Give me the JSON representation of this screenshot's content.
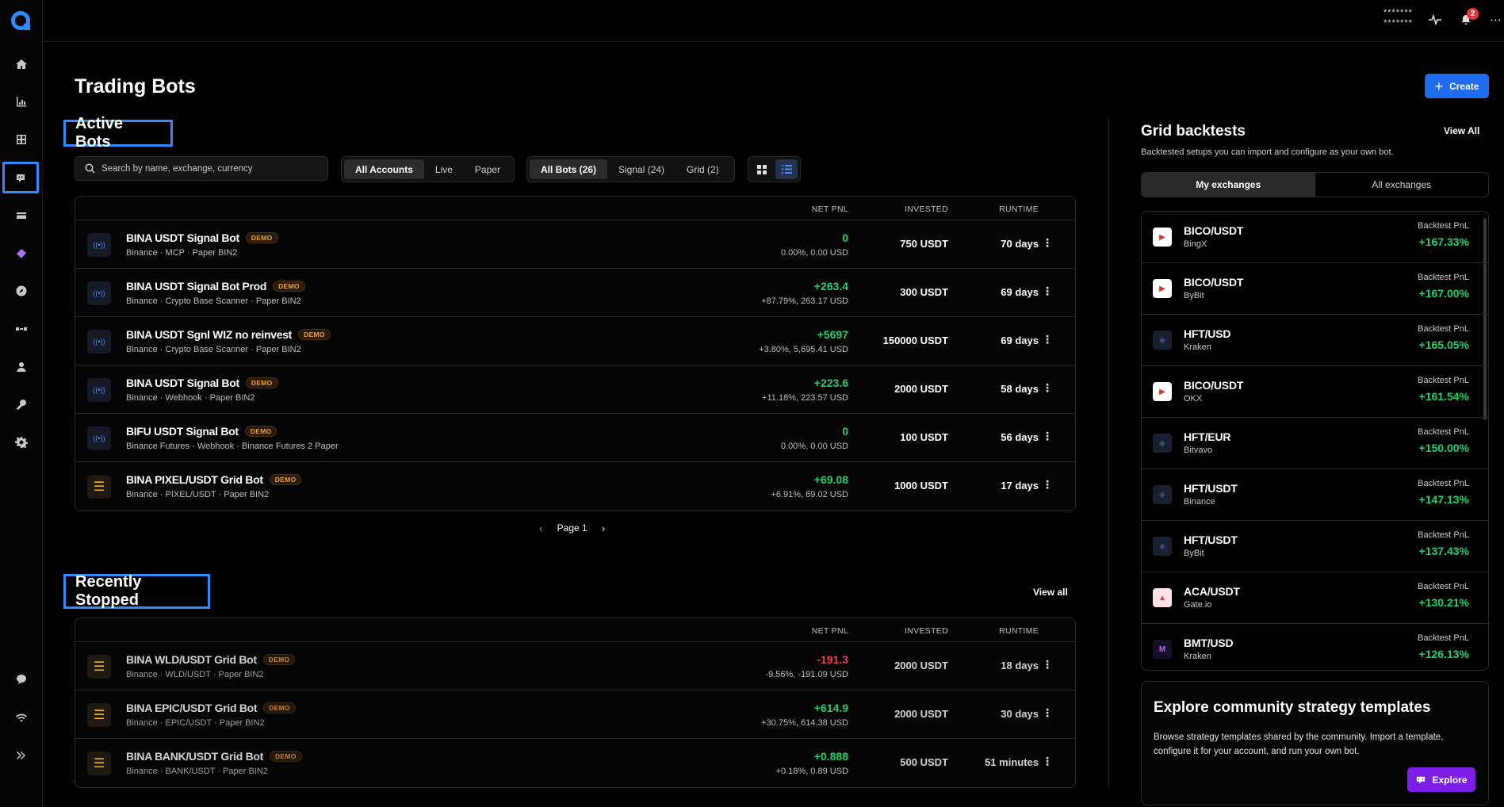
{
  "topbar": {
    "masked_line1": "*******",
    "masked_line2": "*******",
    "notification_count": "2"
  },
  "sidebar": {
    "items": [
      "home-icon",
      "chart-icon",
      "grid-icon",
      "bot-icon",
      "card-icon",
      "layers-icon",
      "compass-icon",
      "connection-icon",
      "user-icon",
      "key-icon",
      "settings-icon"
    ],
    "bottom": [
      "chat-icon",
      "wifi-icon",
      "expand-icon"
    ]
  },
  "page": {
    "title": "Trading Bots",
    "create_label": "Create"
  },
  "active": {
    "section_title": "Active Bots",
    "search_placeholder": "Search by name, exchange, currency",
    "accounts": [
      "All Accounts",
      "Live",
      "Paper"
    ],
    "bot_filters": [
      "All Bots (26)",
      "Signal (24)",
      "Grid (2)"
    ],
    "columns": {
      "pnl": "NET PNL",
      "invested": "INVESTED",
      "runtime": "RUNTIME"
    },
    "rows": [
      {
        "type": "signal",
        "name": "BINA USDT Signal Bot",
        "badge": "DEMO",
        "sub": "Binance · MCP · Paper BIN2",
        "pnl": "0",
        "pnl_sub": "0.00%, 0.00 USD",
        "invested": "750 USDT",
        "runtime": "70 days"
      },
      {
        "type": "signal",
        "name": "BINA USDT Signal Bot Prod",
        "badge": "DEMO",
        "sub": "Binance · Crypto Base Scanner · Paper BIN2",
        "pnl": "+263.4",
        "pnl_sub": "+87.79%, 263.17 USD",
        "invested": "300 USDT",
        "runtime": "69 days"
      },
      {
        "type": "signal",
        "name": "BINA USDT Sgnl WIZ no reinvest",
        "badge": "DEMO",
        "sub": "Binance · Crypto Base Scanner · Paper BIN2",
        "pnl": "+5697",
        "pnl_sub": "+3.80%, 5,695.41 USD",
        "invested": "150000 USDT",
        "runtime": "69 days"
      },
      {
        "type": "signal",
        "name": "BINA USDT Signal Bot",
        "badge": "DEMO",
        "sub": "Binance · Webhook · Paper BIN2",
        "pnl": "+223.6",
        "pnl_sub": "+11.18%, 223.57 USD",
        "invested": "2000 USDT",
        "runtime": "58 days"
      },
      {
        "type": "signal",
        "name": "BIFU USDT Signal Bot",
        "badge": "DEMO",
        "sub": "Binance Futures · Webhook · Binance Futures 2 Paper",
        "pnl": "0",
        "pnl_sub": "0.00%, 0.00 USD",
        "invested": "100 USDT",
        "runtime": "56 days"
      },
      {
        "type": "grid",
        "name": "BINA PIXEL/USDT Grid Bot",
        "badge": "DEMO",
        "sub": "Binance · PIXEL/USDT · Paper BIN2",
        "pnl": "+69.08",
        "pnl_sub": "+6.91%, 69.02 USD",
        "invested": "1000 USDT",
        "runtime": "17 days"
      }
    ],
    "page_label": "Page 1"
  },
  "stopped": {
    "section_title": "Recently Stopped",
    "view_all": "View all",
    "columns": {
      "pnl": "NET PNL",
      "invested": "INVESTED",
      "runtime": "RUNTIME"
    },
    "rows": [
      {
        "type": "grid",
        "name": "BINA WLD/USDT Grid Bot",
        "badge": "DEMO",
        "sub": "Binance · WLD/USDT · Paper BIN2",
        "pnl": "-191.3",
        "pnl_sub": "-9.56%, -191.09 USD",
        "invested": "2000 USDT",
        "runtime": "18 days",
        "negative": true
      },
      {
        "type": "grid",
        "name": "BINA EPIC/USDT Grid Bot",
        "badge": "DEMO",
        "sub": "Binance · EPIC/USDT · Paper BIN2",
        "pnl": "+614.9",
        "pnl_sub": "+30.75%, 614.38 USD",
        "invested": "2000 USDT",
        "runtime": "30 days"
      },
      {
        "type": "grid",
        "name": "BINA BANK/USDT Grid Bot",
        "badge": "DEMO",
        "sub": "Binance · BANK/USDT · Paper BIN2",
        "pnl": "+0.888",
        "pnl_sub": "+0.18%, 0.89 USD",
        "invested": "500 USDT",
        "runtime": "51 minutes"
      }
    ]
  },
  "backtests": {
    "title": "Grid backtests",
    "view_all": "View All",
    "subtitle": "Backtested setups you can import and configure as your own bot.",
    "tabs": [
      "My exchanges",
      "All exchanges"
    ],
    "label": "Backtest PnL",
    "rows": [
      {
        "pair": "BICO/USDT",
        "exchange": "BingX",
        "value": "+167.33%",
        "logo": "bico"
      },
      {
        "pair": "BICO/USDT",
        "exchange": "ByBit",
        "value": "+167.00%",
        "logo": "bico"
      },
      {
        "pair": "HFT/USD",
        "exchange": "Kraken",
        "value": "+165.05%",
        "logo": "hft"
      },
      {
        "pair": "BICO/USDT",
        "exchange": "OKX",
        "value": "+161.54%",
        "logo": "bico"
      },
      {
        "pair": "HFT/EUR",
        "exchange": "Bitvavo",
        "value": "+150.00%",
        "logo": "hft"
      },
      {
        "pair": "HFT/USDT",
        "exchange": "Binance",
        "value": "+147.13%",
        "logo": "hft"
      },
      {
        "pair": "HFT/USDT",
        "exchange": "ByBit",
        "value": "+137.43%",
        "logo": "hft"
      },
      {
        "pair": "ACA/USDT",
        "exchange": "Gate.io",
        "value": "+130.21%",
        "logo": "aca"
      },
      {
        "pair": "BMT/USD",
        "exchange": "Kraken",
        "value": "+126.13%",
        "logo": "bmt"
      }
    ]
  },
  "explore": {
    "title": "Explore community strategy templates",
    "text": "Browse strategy templates shared by the community. Import a template, configure it for your account, and run your own bot.",
    "button": "Explore"
  },
  "colors": {
    "accent": "#1f6cf0",
    "positive": "#1fd16b",
    "negative": "#ef4050",
    "demo": "#f0a030",
    "explore": "#7b1fe6"
  }
}
